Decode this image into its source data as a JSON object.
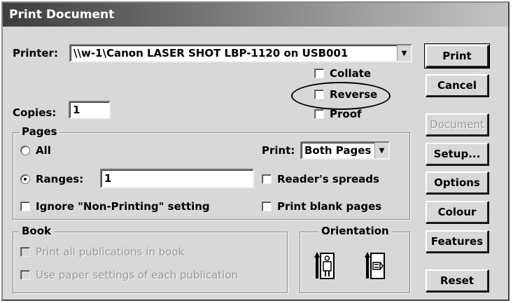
{
  "window": {
    "title": "Print Document"
  },
  "printer": {
    "label": "Printer:",
    "value": "\\\\w-1\\Canon LASER SHOT LBP-1120 on USB001",
    "arrow": "▼"
  },
  "copies": {
    "label": "Copies:",
    "value": "1"
  },
  "options": {
    "collate": {
      "label": "Collate",
      "checked": false
    },
    "reverse": {
      "label": "Reverse",
      "checked": false
    },
    "proof": {
      "label": "Proof",
      "checked": false
    }
  },
  "pages": {
    "title": "Pages",
    "all_label": "All",
    "ranges_label": "Ranges:",
    "ranges_value": "1",
    "selected": "ranges",
    "print_label": "Print:",
    "print_value": "Both Pages",
    "print_arrow": "▼",
    "readers_spreads": "Reader's spreads",
    "ignore_nonprinting": "Ignore \"Non-Printing\" setting",
    "print_blank": "Print blank pages"
  },
  "book": {
    "title": "Book",
    "print_all": "Print all publications in book",
    "use_paper": "Use paper settings of each publication"
  },
  "orientation": {
    "title": "Orientation"
  },
  "buttons": {
    "print": "Print",
    "cancel": "Cancel",
    "document": "Document",
    "setup": "Setup...",
    "options": "Options",
    "colour": "Colour",
    "features": "Features",
    "reset": "Reset"
  }
}
